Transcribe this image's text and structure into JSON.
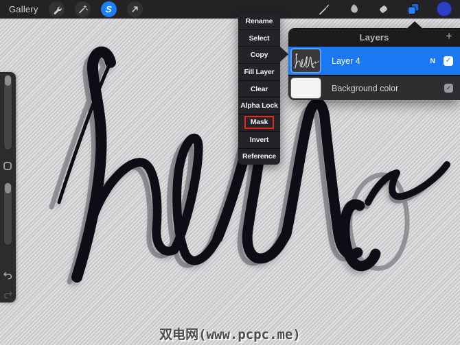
{
  "top_bar": {
    "gallery_label": "Gallery",
    "selection_tool_letter": "S"
  },
  "sidebar": {
    "sliders": [
      "brush-size",
      "brush-opacity"
    ],
    "buttons": [
      "modify",
      "undo",
      "redo"
    ]
  },
  "context_menu": {
    "items": [
      "Rename",
      "Select",
      "Copy",
      "Fill Layer",
      "Clear",
      "Alpha Lock",
      "Mask",
      "Invert",
      "Reference"
    ],
    "highlighted_item": "Mask"
  },
  "layers_panel": {
    "title": "Layers",
    "add_icon": "+",
    "rows": [
      {
        "name": "Layer 4",
        "blend_mode": "N",
        "checked": true,
        "selected": true,
        "thumbnail": "hello-script"
      },
      {
        "name": "Background color",
        "checked": true,
        "selected": false,
        "thumbnail": "white-swatch"
      }
    ],
    "checkmark": "✓"
  },
  "canvas": {
    "artwork_word": "hello",
    "ink_color": "#101012",
    "guide_color": "#8c8c90",
    "background_color": "#d3d3d5"
  },
  "watermark": {
    "text": "双电网(www.pcpc.me)"
  },
  "colors": {
    "accent_blue": "#1a79f2",
    "toolbar_bg": "#232325",
    "menu_bg": "#242428",
    "mask_outline_red": "#e8281e",
    "color_swatch_blue": "#2c41c6"
  }
}
